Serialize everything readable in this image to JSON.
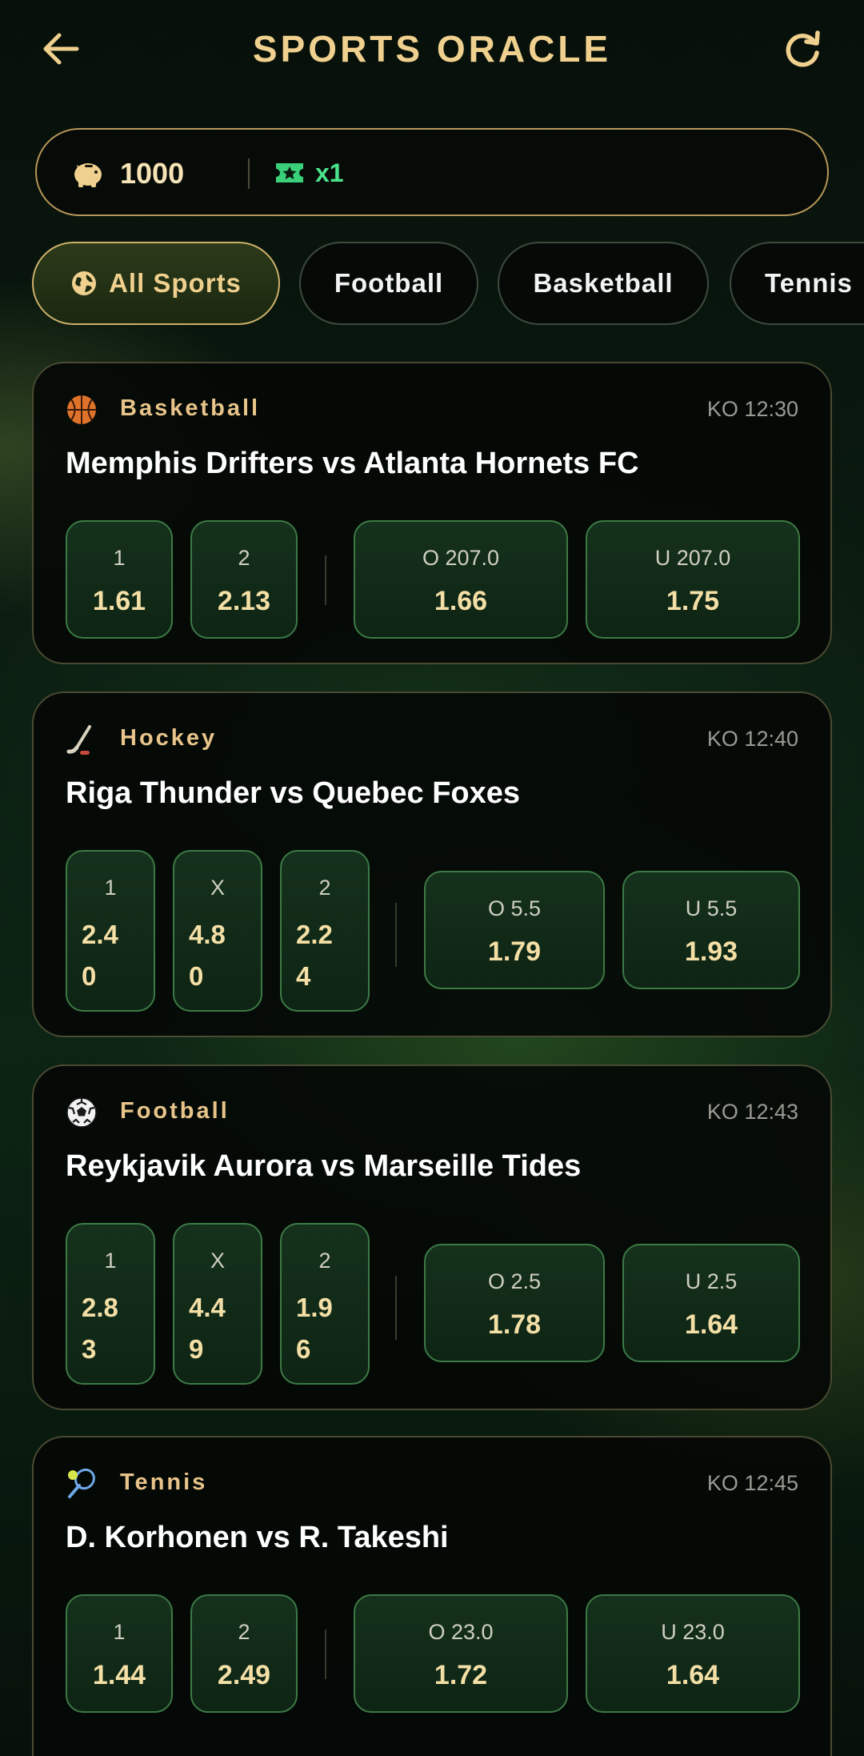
{
  "header": {
    "title": "SPORTS ORACLE",
    "back_icon": "arrow-left-icon",
    "refresh_icon": "refresh-icon"
  },
  "balance": {
    "coins": "1000",
    "tickets": "x1",
    "coin_icon": "piggy-bank-icon",
    "ticket_icon": "ticket-star-icon"
  },
  "filters": [
    {
      "label": "All Sports",
      "active": true,
      "icon": "globe-icon"
    },
    {
      "label": "Football",
      "active": false
    },
    {
      "label": "Basketball",
      "active": false
    },
    {
      "label": "Tennis",
      "active": false
    }
  ],
  "matches": [
    {
      "sport": "Basketball",
      "sport_icon": "basketball-icon",
      "ko": "KO 12:30",
      "title": "Memphis Drifters vs Atlanta Hornets FC",
      "moneyline": [
        {
          "label": "1",
          "value": "1.61"
        },
        {
          "label": "2",
          "value": "2.13"
        }
      ],
      "totals": [
        {
          "label": "O 207.0",
          "value": "1.66"
        },
        {
          "label": "U 207.0",
          "value": "1.75"
        }
      ]
    },
    {
      "sport": "Hockey",
      "sport_icon": "hockey-stick-icon",
      "ko": "KO 12:40",
      "title": "Riga Thunder vs Quebec Foxes",
      "moneyline": [
        {
          "label": "1",
          "value": "2.40"
        },
        {
          "label": "X",
          "value": "4.80"
        },
        {
          "label": "2",
          "value": "2.24"
        }
      ],
      "totals": [
        {
          "label": "O 5.5",
          "value": "1.79"
        },
        {
          "label": "U 5.5",
          "value": "1.93"
        }
      ]
    },
    {
      "sport": "Football",
      "sport_icon": "soccer-ball-icon",
      "ko": "KO 12:43",
      "title": "Reykjavik Aurora vs Marseille Tides",
      "moneyline": [
        {
          "label": "1",
          "value": "2.83"
        },
        {
          "label": "X",
          "value": "4.49"
        },
        {
          "label": "2",
          "value": "1.96"
        }
      ],
      "totals": [
        {
          "label": "O 2.5",
          "value": "1.78"
        },
        {
          "label": "U 2.5",
          "value": "1.64"
        }
      ]
    },
    {
      "sport": "Tennis",
      "sport_icon": "tennis-racket-icon",
      "ko": "KO 12:45",
      "title": "D. Korhonen vs R. Takeshi",
      "moneyline": [
        {
          "label": "1",
          "value": "1.44"
        },
        {
          "label": "2",
          "value": "2.49"
        }
      ],
      "totals": [
        {
          "label": "O 23.0",
          "value": "1.72"
        },
        {
          "label": "U 23.0",
          "value": "1.64"
        }
      ]
    }
  ]
}
